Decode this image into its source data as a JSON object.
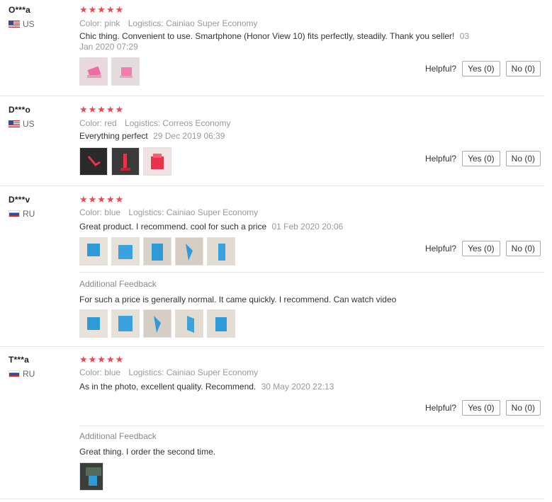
{
  "reviews": [
    {
      "user": "O***a",
      "country": "US",
      "stars": "★★★★★",
      "color_label": "Color:",
      "color_value": "pink",
      "logistics_label": "Logistics:",
      "logistics_value": "Cainiao Super Economy",
      "text": "Chic thing. Convenient to use. Smartphone (Honor View 10) fits perfectly, steadily. Thank you seller!",
      "date_line1": "03",
      "date_line2": "Jan 2020 07:29",
      "helpful_label": "Helpful?",
      "yes_label": "Yes (0)",
      "no_label": "No (0)"
    },
    {
      "user": "D***o",
      "country": "US",
      "stars": "★★★★★",
      "color_label": "Color:",
      "color_value": "red",
      "logistics_label": "Logistics:",
      "logistics_value": "Correos Economy",
      "text": "Everything perfect",
      "date": "29 Dec 2019 06:39",
      "helpful_label": "Helpful?",
      "yes_label": "Yes (0)",
      "no_label": "No (0)"
    },
    {
      "user": "D***v",
      "country": "RU",
      "stars": "★★★★★",
      "color_label": "Color:",
      "color_value": "blue",
      "logistics_label": "Logistics:",
      "logistics_value": "Cainiao Super Economy",
      "text": "Great product. I recommend. cool for such a price",
      "date": "01 Feb 2020 20:06",
      "helpful_label": "Helpful?",
      "yes_label": "Yes (0)",
      "no_label": "No (0)",
      "additional_label": "Additional Feedback",
      "additional_text": "For such a price is generally normal. It came quickly. I recommend. Can watch video"
    },
    {
      "user": "T***a",
      "country": "RU",
      "stars": "★★★★★",
      "color_label": "Color:",
      "color_value": "blue",
      "logistics_label": "Logistics:",
      "logistics_value": "Cainiao Super Economy",
      "text": "As in the photo, excellent quality. Recommend.",
      "date": "30 May 2020 22:13",
      "helpful_label": "Helpful?",
      "yes_label": "Yes (0)",
      "no_label": "No (0)",
      "additional_label": "Additional Feedback",
      "additional_text": "Great thing. I order the second time."
    }
  ],
  "colors": {
    "star": "#f0464f",
    "pink_product": "#f06aa3",
    "red_product": "#e8334a",
    "blue_product": "#2f9ad8"
  }
}
